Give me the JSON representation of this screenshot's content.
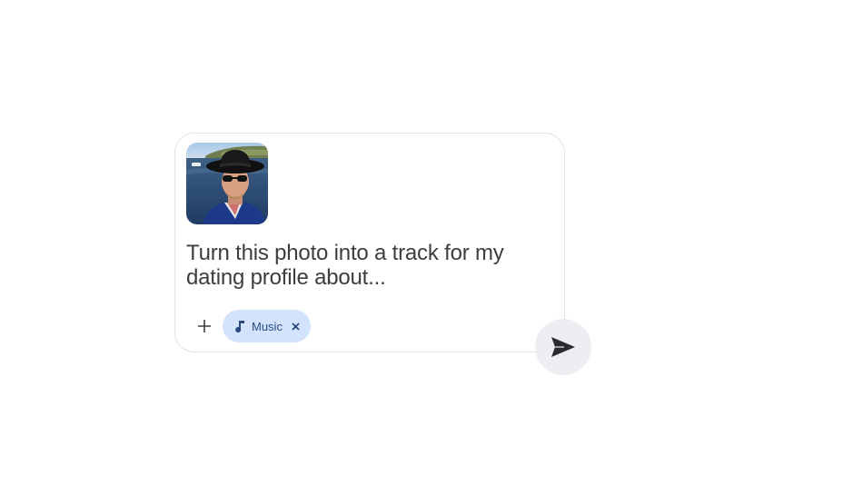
{
  "composer": {
    "prompt_text": "Turn this photo into a track for my dating profile about...",
    "attachment": {
      "icon": "photo-thumbnail"
    },
    "toolbar": {
      "add_icon": "plus-icon",
      "chip": {
        "icon": "music-note-icon",
        "label": "Music",
        "close_icon": "close-icon"
      }
    },
    "send_icon": "send-icon"
  },
  "colors": {
    "chip_background": "#d3e3fd",
    "chip_text": "#2a4a7f",
    "prompt_text": "#3c3d40",
    "send_background": "#eceef2",
    "border": "#e3e3e6"
  }
}
